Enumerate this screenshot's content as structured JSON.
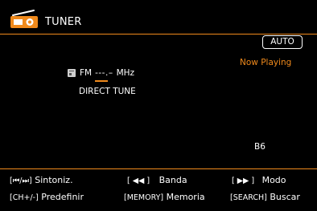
{
  "header": {
    "title": "TUNER",
    "icon": "radio-icon"
  },
  "colors": {
    "accent": "#f08a1c",
    "background": "#000000",
    "text": "#ffffff"
  },
  "status": {
    "mode_badge": "AUTO",
    "now_playing": "Now Playing"
  },
  "tuner": {
    "band": "FM",
    "frequency": "---.–",
    "unit": "MHz",
    "mode": "DIRECT TUNE",
    "preset": "B6"
  },
  "keys": {
    "row1": [
      {
        "key": "[⏮/⏭]",
        "label": "Sintoniz."
      },
      {
        "key": "[ ◀◀ ]",
        "label": "Banda"
      },
      {
        "key": "[ ▶▶ ]",
        "label": "Modo"
      }
    ],
    "row2": [
      {
        "key": "[CH+/-]",
        "label": "Predefinir"
      },
      {
        "key": "[MEMORY]",
        "label": "Memoria"
      },
      {
        "key": "[SEARCH]",
        "label": "Buscar"
      }
    ]
  }
}
